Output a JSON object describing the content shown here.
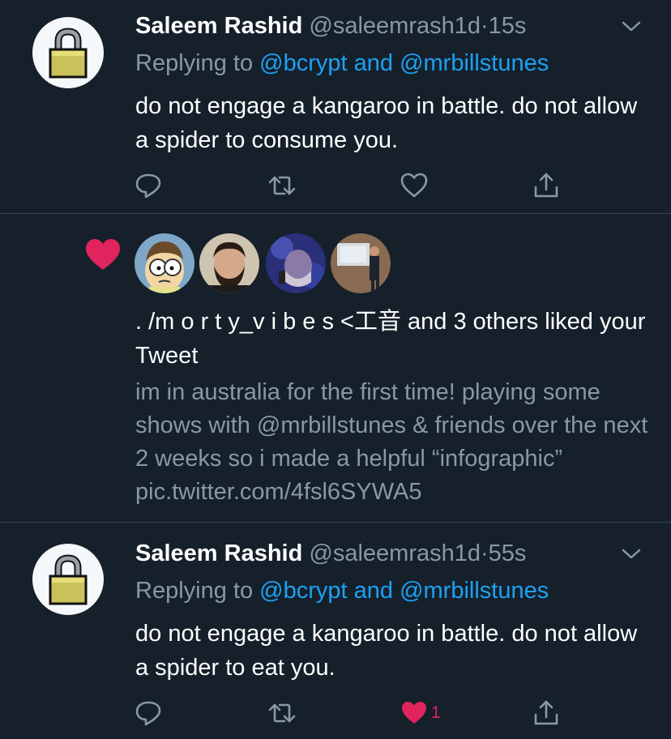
{
  "tweets": [
    {
      "name": "Saleem Rashid",
      "handle": "@saleemrash1d",
      "separator": "·",
      "time": "15s",
      "replying_prefix": "Replying to ",
      "replying_to": "@bcrypt and @mrbillstunes",
      "text": "do not engage a kangaroo in battle. do not allow a spider to consume you.",
      "like_count": ""
    },
    {
      "name": "Saleem Rashid",
      "handle": "@saleemrash1d",
      "separator": "·",
      "time": "55s",
      "replying_prefix": "Replying to ",
      "replying_to": "@bcrypt and @mrbillstunes",
      "text": "do not engage a kangaroo in battle. do not allow a spider to eat you.",
      "like_count": "1"
    }
  ],
  "notification": {
    "liker_name": ". /m o r t y_v i b e s <工音",
    "suffix": " and 3 others liked your Tweet",
    "quoted_text": "im in australia for the first time! playing some shows with @mrbillstunes & friends over the next 2 weeks so i made a helpful “infographic” pic.twitter.com/4fsl6SYWA5"
  },
  "colors": {
    "background": "#15202b",
    "secondary_text": "#8899a6",
    "link": "#1da1f2",
    "like": "#e0245e",
    "divider": "#38444d"
  },
  "icons": [
    "reply-icon",
    "retweet-icon",
    "like-icon",
    "share-icon",
    "chevron-down-icon",
    "heart-filled-icon",
    "lock-avatar-icon"
  ]
}
